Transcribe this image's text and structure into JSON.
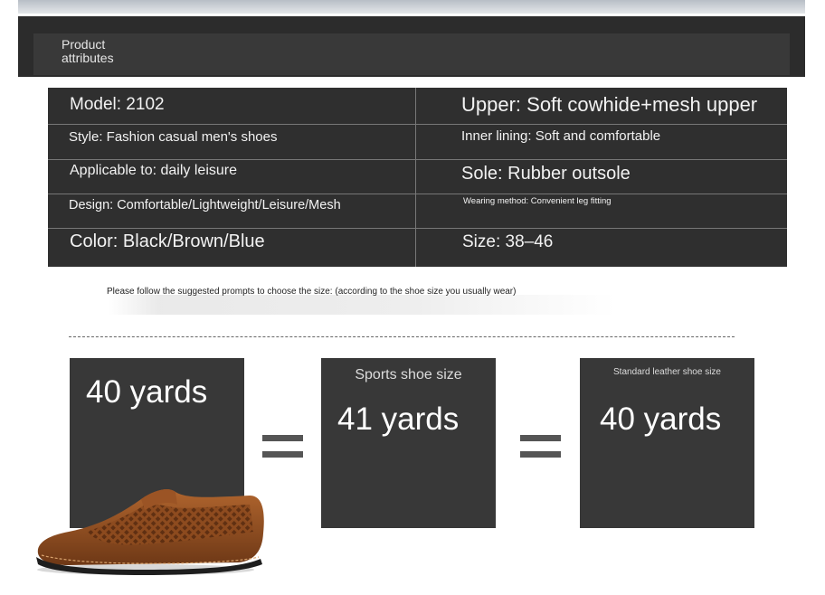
{
  "header": {
    "title_line1": "Product",
    "title_line2": "attributes"
  },
  "attributes": {
    "model": "Model: 2102",
    "upper": "Upper: Soft cowhide+mesh upper",
    "style": "Style: Fashion casual men's shoes",
    "inner_lining": "Inner lining: Soft and comfortable",
    "applicable": "Applicable to: daily leisure",
    "sole": "Sole: Rubber outsole",
    "design": "Design: Comfortable/Lightweight/Leisure/Mesh",
    "wearing_method": "Wearing method: Convenient leg fitting",
    "color": "Color: Black/Brown/Blue",
    "size": "Size: 38–46"
  },
  "instruction": "Please follow the suggested prompts to choose the size: (according to the shoe size you usually wear)",
  "size_boxes": {
    "your_size": {
      "value": "40 yards"
    },
    "sports": {
      "caption": "Sports shoe size",
      "value": "41 yards"
    },
    "leather": {
      "caption": "Standard leather shoe size",
      "value": "40 yards"
    }
  },
  "colors": {
    "dark_panel": "#2f2f2f",
    "size_box": "#383838",
    "shoe_leather": "#8a4a22"
  },
  "icons": {
    "equals": "equals-icon",
    "shoe": "shoe-image"
  }
}
